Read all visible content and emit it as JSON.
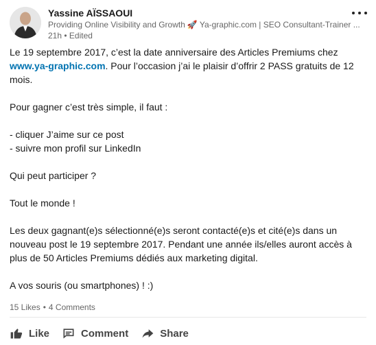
{
  "post": {
    "author": {
      "name": "Yassine AÏSSAOUI",
      "headline_part1": "Providing Online Visibility and Growth",
      "headline_part2": "Ya-graphic.com | SEO Consultant-Trainer ...",
      "time": "21h",
      "edited": "Edited"
    },
    "body": {
      "p1_text": "Le 19 septembre 2017, c’est la date anniversaire des Articles Premiums chez ",
      "p1_link": "www.ya-graphic.com",
      "p1_rest": ". Pour l’occasion j’ai le plaisir d’offrir 2 PASS gratuits de 12 mois.",
      "p2": "Pour gagner c’est très simple, il faut :",
      "bullet1": "- cliquer J’aime sur ce post",
      "bullet2": "- suivre mon profil sur LinkedIn",
      "p3": "Qui peut participer ?",
      "p4": "Tout le monde !",
      "p5": "Les deux gagnant(e)s sélectionné(e)s seront contacté(e)s et cité(e)s dans un nouveau post le 19 septembre 2017. Pendant une année ils/elles auront accès à plus de 50 Articles Premiums dédiés aux marketing digital.",
      "p6": "A vos souris (ou smartphones) ! :)"
    },
    "social": {
      "likes": "15 Likes",
      "comments": "4 Comments"
    },
    "actions": {
      "like": "Like",
      "comment": "Comment",
      "share": "Share"
    }
  },
  "icons": {
    "more": "more-horizontal-icon",
    "rocket": "rocket-icon",
    "like": "thumbs-up-icon",
    "comment": "comment-icon",
    "share": "share-arrow-icon"
  },
  "colors": {
    "link": "#0073b1",
    "meta": "#666666",
    "action": "#444444"
  }
}
